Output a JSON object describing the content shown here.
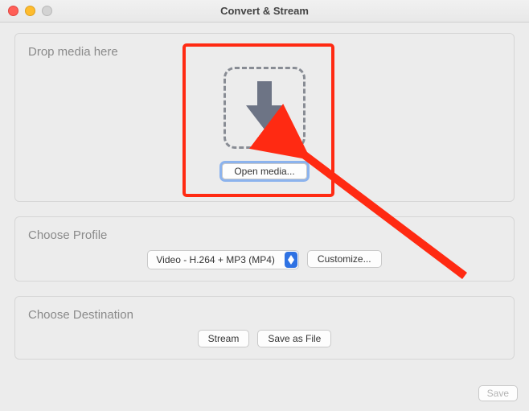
{
  "window": {
    "title": "Convert & Stream"
  },
  "drop": {
    "title": "Drop media here",
    "open_label": "Open media..."
  },
  "profile": {
    "title": "Choose Profile",
    "selected": "Video - H.264 + MP3 (MP4)",
    "customize_label": "Customize..."
  },
  "destination": {
    "title": "Choose Destination",
    "stream_label": "Stream",
    "save_label": "Save as File"
  },
  "footer": {
    "save_label": "Save"
  },
  "annotation": {
    "color": "#ff2a12"
  }
}
